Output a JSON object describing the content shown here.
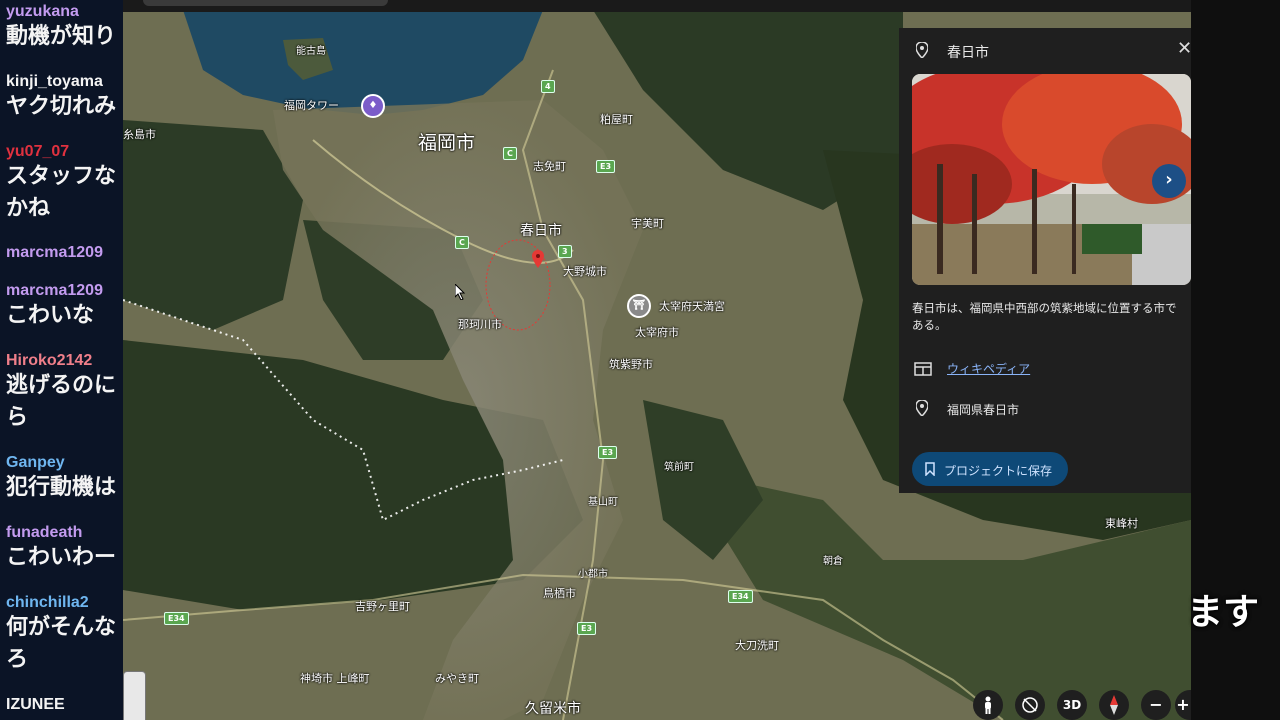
{
  "chat": {
    "messages": [
      {
        "user": "yuzukana",
        "user_color": "#c39bef",
        "text": [
          "動機が知り"
        ]
      },
      {
        "user": "kinji_toyama",
        "user_color": "#f4f4f4",
        "text": [
          "ヤク切れみ"
        ]
      },
      {
        "user": "yu07_07",
        "user_color": "#e0313f",
        "text": [
          "スタッフな",
          "かね"
        ]
      },
      {
        "user": "marcma1209",
        "user_color": "#c39bef",
        "text": []
      },
      {
        "user": "marcma1209",
        "user_color": "#c39bef",
        "text": [
          "こわいな"
        ]
      },
      {
        "user": "Hiroko2142",
        "user_color": "#f07f8a",
        "text": [
          "逃げるのに",
          "ら"
        ]
      },
      {
        "user": "Ganpey",
        "user_color": "#6fb6f0",
        "text": [
          "犯行動機は"
        ]
      },
      {
        "user": "funadeath",
        "user_color": "#c39bef",
        "text": [
          "こわいわー"
        ]
      },
      {
        "user": "chinchilla2",
        "user_color": "#6fb6f0",
        "text": [
          "何がそんな",
          "ろ"
        ]
      },
      {
        "user": "IZUNEE",
        "user_color": "#f4f4f4",
        "text": []
      }
    ]
  },
  "map": {
    "labels": {
      "noko": "能古島",
      "tower": "福岡タワー",
      "fukuoka": "福岡市",
      "kasuya": "粕屋町",
      "shime": "志免町",
      "umi": "宇美町",
      "kasuga": "春日市",
      "onojo": "大野城市",
      "dazaifu_tenmangu": "太宰府天満宮",
      "nakagawa": "那珂川市",
      "dazaifu": "太宰府市",
      "chikushino": "筑紫野市",
      "chikuzen": "筑前町",
      "kiyama": "基山町",
      "yoshinogari": "吉野ヶ里町",
      "tosu": "鳥栖市",
      "ogori": "小郡市",
      "tachiarai": "大刀洗町",
      "kanzaki": "神埼市 上峰町",
      "miyaki": "みやき町",
      "kurume": "久留米市",
      "toho": "東峰村",
      "asakura": "朝倉",
      "itoshima": "糸島市"
    },
    "road_badges": [
      "4",
      "C",
      "E3",
      "C",
      "3",
      "E3",
      "E34",
      "E3",
      "E34"
    ],
    "poi_tower_glyph": "♦",
    "poi_tenmangu_glyph": "⛩"
  },
  "panel": {
    "title": "春日市",
    "close": "✕",
    "next": "›",
    "description_lines": [
      "春日市は、福岡県中西部の筑紫地域に位置する市で",
      "ある。"
    ],
    "wiki_link": "ウィキペディア",
    "address": "福岡県春日市",
    "save_button": "プロジェクトに保存"
  },
  "controls": {
    "mode_3d": "3D",
    "zoom_out": "−",
    "zoom_in": "+"
  },
  "overlay_text": "ます",
  "colors": {
    "accent_blue": "#0e4977",
    "link_blue": "#8ab4f8",
    "pin_red": "#e53935",
    "panel_bg": "#1f1f1f"
  }
}
